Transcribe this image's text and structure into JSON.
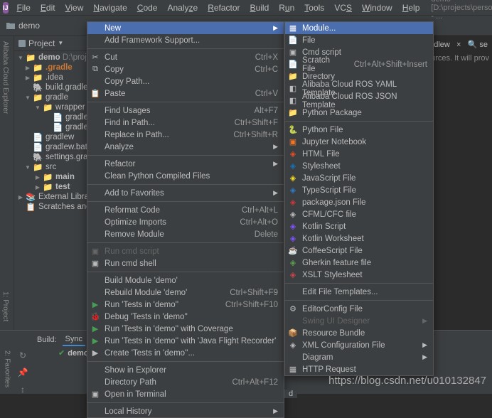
{
  "menubar": {
    "items": [
      "File",
      "Edit",
      "View",
      "Navigate",
      "Code",
      "Analyze",
      "Refactor",
      "Build",
      "Run",
      "Tools",
      "VCS",
      "Window",
      "Help"
    ],
    "title": "demo [D:\\projects\\personal\\demo] - ..."
  },
  "toolbar": {
    "project_label": "demo"
  },
  "panel": {
    "header": "Project"
  },
  "left_tabs": {
    "project": "1: Project",
    "alibaba": "Alibaba Cloud Explorer"
  },
  "tree": {
    "root": "demo",
    "root_path": "D:\\projec",
    "items": [
      ".gradle",
      ".idea",
      "build.gradle",
      "gradle",
      "wrapper",
      "gradle-",
      "gradle-",
      "gradlew",
      "gradlew.bat",
      "settings.grad",
      "src",
      "main",
      "test"
    ],
    "ext_lib": "External Librarie",
    "scratches": "Scratches and Co"
  },
  "context": {
    "new": "New",
    "add_framework": "Add Framework Support...",
    "cut": {
      "label": "Cut",
      "sc": "Ctrl+X"
    },
    "copy": {
      "label": "Copy",
      "sc": "Ctrl+C"
    },
    "copy_path": "Copy Path...",
    "paste": {
      "label": "Paste",
      "sc": "Ctrl+V"
    },
    "find_usages": {
      "label": "Find Usages",
      "sc": "Alt+F7"
    },
    "find_in_path": {
      "label": "Find in Path...",
      "sc": "Ctrl+Shift+F"
    },
    "replace_in_path": {
      "label": "Replace in Path...",
      "sc": "Ctrl+Shift+R"
    },
    "analyze": "Analyze",
    "refactor": "Refactor",
    "clean_python": "Clean Python Compiled Files",
    "add_favorites": "Add to Favorites",
    "reformat": {
      "label": "Reformat Code",
      "sc": "Ctrl+Alt+L"
    },
    "optimize": {
      "label": "Optimize Imports",
      "sc": "Ctrl+Alt+O"
    },
    "remove_module": {
      "label": "Remove Module",
      "sc": "Delete"
    },
    "run_cmd_script": "Run cmd script",
    "run_cmd_shell": "Run cmd shell",
    "build_module": "Build Module 'demo'",
    "rebuild_module": {
      "label": "Rebuild Module 'demo'",
      "sc": "Ctrl+Shift+F9"
    },
    "run_tests": {
      "label": "Run 'Tests in 'demo''",
      "sc": "Ctrl+Shift+F10"
    },
    "debug_tests": "Debug 'Tests in 'demo''",
    "coverage": "Run 'Tests in 'demo'' with Coverage",
    "flight_recorder": "Run 'Tests in 'demo'' with 'Java Flight Recorder'",
    "create_tests": "Create 'Tests in 'demo''...",
    "show_explorer": "Show in Explorer",
    "directory_path": {
      "label": "Directory Path",
      "sc": "Ctrl+Alt+F12"
    },
    "open_terminal": "Open in Terminal",
    "local_history": "Local History"
  },
  "submenu": {
    "module": "Module...",
    "file": "File",
    "cmd_script": "Cmd script",
    "scratch": {
      "label": "Scratch File",
      "sc": "Ctrl+Alt+Shift+Insert"
    },
    "directory": "Directory",
    "ros_yaml": "Alibaba Cloud ROS YAML Template",
    "ros_json": "Alibaba Cloud ROS JSON Template",
    "python_pkg": "Python Package",
    "python_file": "Python File",
    "jupyter": "Jupyter Notebook",
    "html": "HTML File",
    "stylesheet": "Stylesheet",
    "javascript": "JavaScript File",
    "typescript": "TypeScript File",
    "package_json": "package.json File",
    "cfml": "CFML/CFC file",
    "kotlin_script": "Kotlin Script",
    "kotlin_worksheet": "Kotlin Worksheet",
    "coffee": "CoffeeScript File",
    "gherkin": "Gherkin feature file",
    "xslt": "XSLT Stylesheet",
    "edit_templates": "Edit File Templates...",
    "editorconfig": "EditorConfig File",
    "swing": "Swing UI Designer",
    "resource_bundle": "Resource Bundle",
    "xml_config": "XML Configuration File",
    "diagram": "Diagram",
    "http": "HTTP Request",
    "trailing": "d"
  },
  "editor": {
    "right_tab_hint": "radlew",
    "search_hint": "se",
    "hint": "ources. It will prov"
  },
  "build": {
    "label": "Build:",
    "sync": "Sync",
    "status": "demo: finis"
  },
  "favorites_tab": "2: Favorites",
  "watermark": "https://blog.csdn.net/u010132847"
}
